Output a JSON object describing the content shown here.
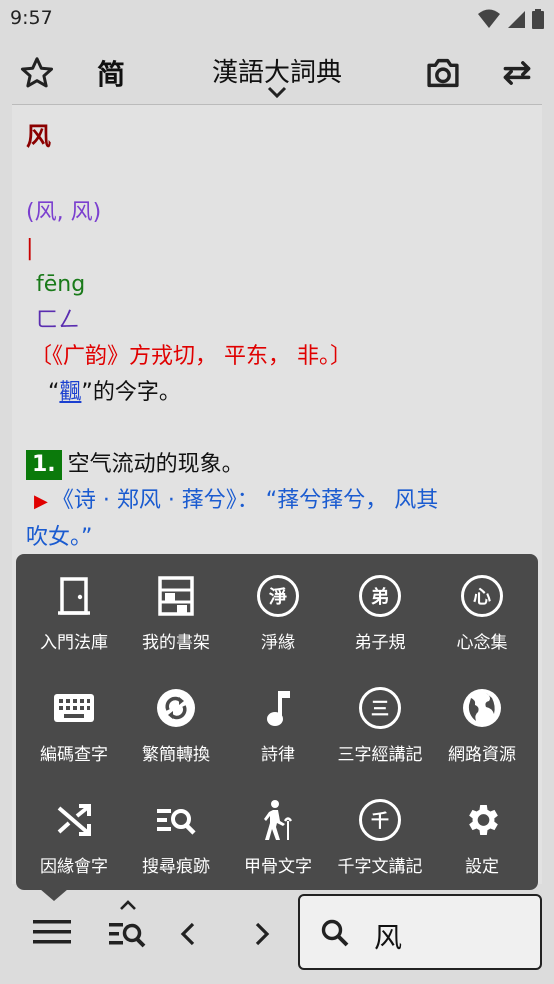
{
  "status": {
    "time": "9:57"
  },
  "toolbar": {
    "mode_label": "简",
    "title": "漢語大詞典"
  },
  "entry": {
    "headword": "风",
    "variants": "(风, 风)",
    "radical_mark": "|",
    "pinyin": "fēng",
    "zhuyin": "ㄈㄥ",
    "rhyme": "〔《广韵》方戎切， 平东， 非。〕",
    "note_prefix": "“",
    "note_link": "飌",
    "note_suffix": "”的今字。",
    "sense_number": "1.",
    "sense_text": "空气流动的现象。",
    "quote_line1": "《诗 · 郑风 · 萚兮》： “萚兮萚兮， 风其",
    "quote_line2": "吹女。”"
  },
  "menu": {
    "items": [
      {
        "label": "入門法庫",
        "icon": "door-icon"
      },
      {
        "label": "我的書架",
        "icon": "bookshelf-icon"
      },
      {
        "label": "淨緣",
        "icon": "circle-char-icon",
        "char": "淨"
      },
      {
        "label": "弟子規",
        "icon": "circle-char-icon",
        "char": "弟"
      },
      {
        "label": "心念集",
        "icon": "circle-char-icon",
        "char": "心"
      },
      {
        "label": "編碼查字",
        "icon": "keyboard-icon"
      },
      {
        "label": "繁簡轉換",
        "icon": "sync-icon"
      },
      {
        "label": "詩律",
        "icon": "music-note-icon"
      },
      {
        "label": "三字經講記",
        "icon": "circle-char-icon",
        "char": "三"
      },
      {
        "label": "網路資源",
        "icon": "globe-icon"
      },
      {
        "label": "因緣會字",
        "icon": "shuffle-icon"
      },
      {
        "label": "搜尋痕跡",
        "icon": "search-history-icon"
      },
      {
        "label": "甲骨文字",
        "icon": "elderly-walker-icon"
      },
      {
        "label": "千字文講記",
        "icon": "circle-char-icon",
        "char": "千"
      },
      {
        "label": "設定",
        "icon": "gear-icon"
      }
    ]
  },
  "search": {
    "value": "风"
  },
  "colors": {
    "headword": "#8b0000",
    "variants": "#7b3fcf",
    "pinyin": "#1a7a1a",
    "rhyme": "#e00000",
    "link": "#1a3fd0",
    "sense_badge": "#0b7a0b",
    "menu_bg": "#4a4a4a"
  }
}
